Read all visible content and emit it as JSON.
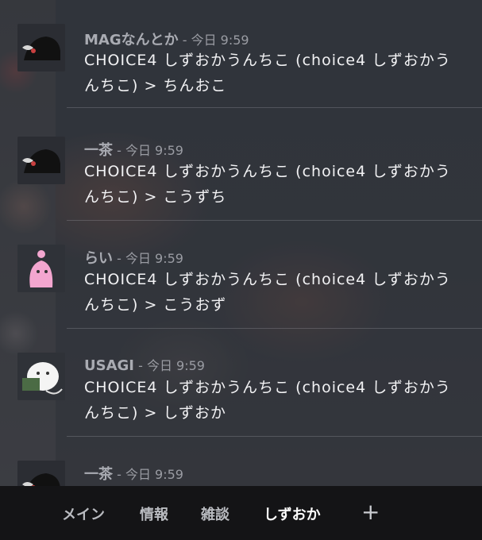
{
  "messages": [
    {
      "name": "MAGなんとか",
      "meta": "- 今日 9:59",
      "text": "CHOICE4 しずおかうんちこ (choice4 しずおかうんちこ) > ちんおこ"
    },
    {
      "name": "一茶",
      "meta": "- 今日 9:59",
      "text": "CHOICE4 しずおかうんちこ (choice4 しずおかうんちこ) > こうずち"
    },
    {
      "name": "らい",
      "meta": "- 今日 9:59",
      "text": "CHOICE4 しずおかうんちこ (choice4 しずおかうんちこ) > こうおず"
    },
    {
      "name": "USAGI",
      "meta": "- 今日 9:59",
      "text": "CHOICE4 しずおかうんちこ (choice4 しずおかうんちこ) > しずおか"
    },
    {
      "name": "一茶",
      "meta": "- 今日 9:59",
      "text": ""
    }
  ],
  "tabs": [
    {
      "label": "メイン"
    },
    {
      "label": "情報"
    },
    {
      "label": "雑談"
    },
    {
      "label": "しずおか",
      "active": true
    },
    {
      "label": "+"
    }
  ],
  "icons": {
    "avatar_1": "black-bird-icon",
    "avatar_2": "black-bird-icon",
    "avatar_3": "pink-creature-icon",
    "avatar_4": "white-bird-with-book-icon",
    "avatar_5": "black-bird-icon"
  },
  "colors": {
    "tabbar_bg": "#141416",
    "name_text": "#a9abb2",
    "message_text": "#f2f2f4"
  }
}
